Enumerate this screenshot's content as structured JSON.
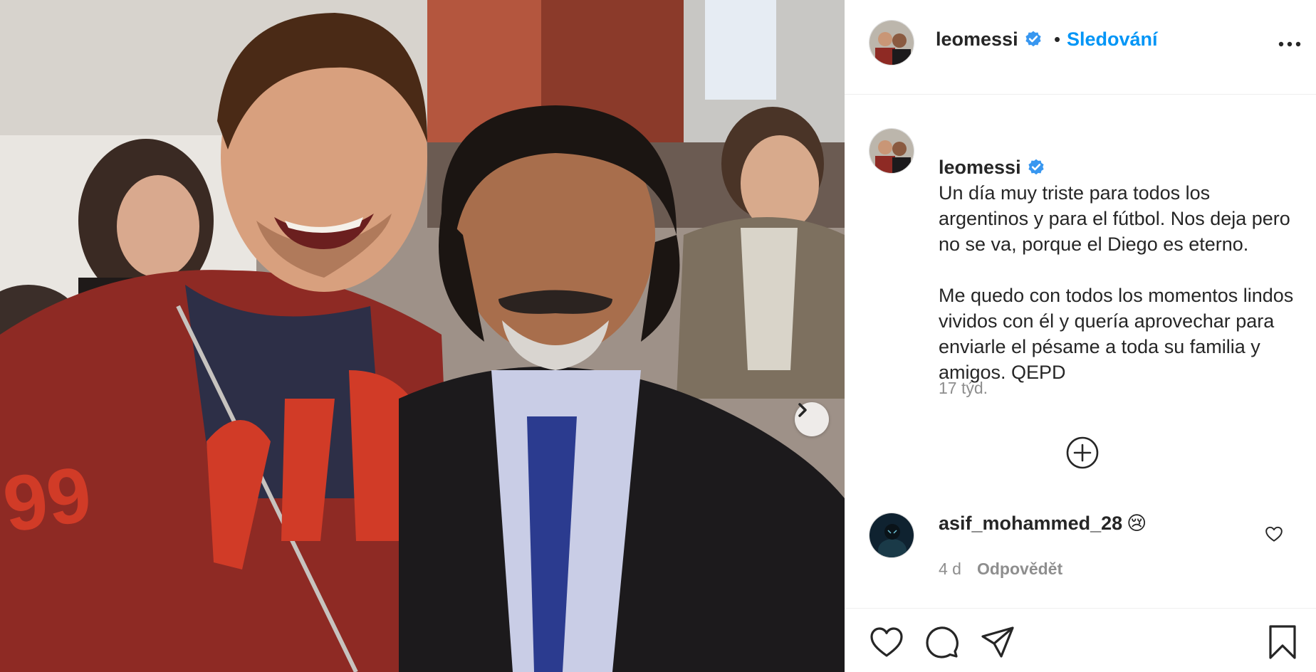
{
  "post": {
    "username": "leomessi",
    "separator": "•",
    "follow_label": "Sledování",
    "caption_paragraph_1": "Un día muy triste para todos los argentinos y para el fútbol. Nos deja pero no se va, porque el Diego es eterno.",
    "caption_paragraph_2": "Me quedo con todos los momentos lindos vividos con él y quería aprovechar para enviarle el pésame a toda su familia y amigos. QEPD",
    "time": "17 týd."
  },
  "comments": [
    {
      "username": "asif_mohammed_28",
      "text": "😢",
      "time": "4 d",
      "reply_label": "Odpovědět"
    }
  ],
  "icons": {
    "verified": "verified-badge-icon",
    "more": "more-options-icon",
    "next": "chevron-right-icon",
    "load_more": "plus-circle-icon",
    "like": "heart-icon",
    "comment": "comment-icon",
    "share": "paper-plane-icon",
    "save": "bookmark-icon"
  },
  "colors": {
    "link": "#0095f6",
    "verified": "#3897f0",
    "text": "#262626",
    "secondary": "#8e8e8e"
  }
}
